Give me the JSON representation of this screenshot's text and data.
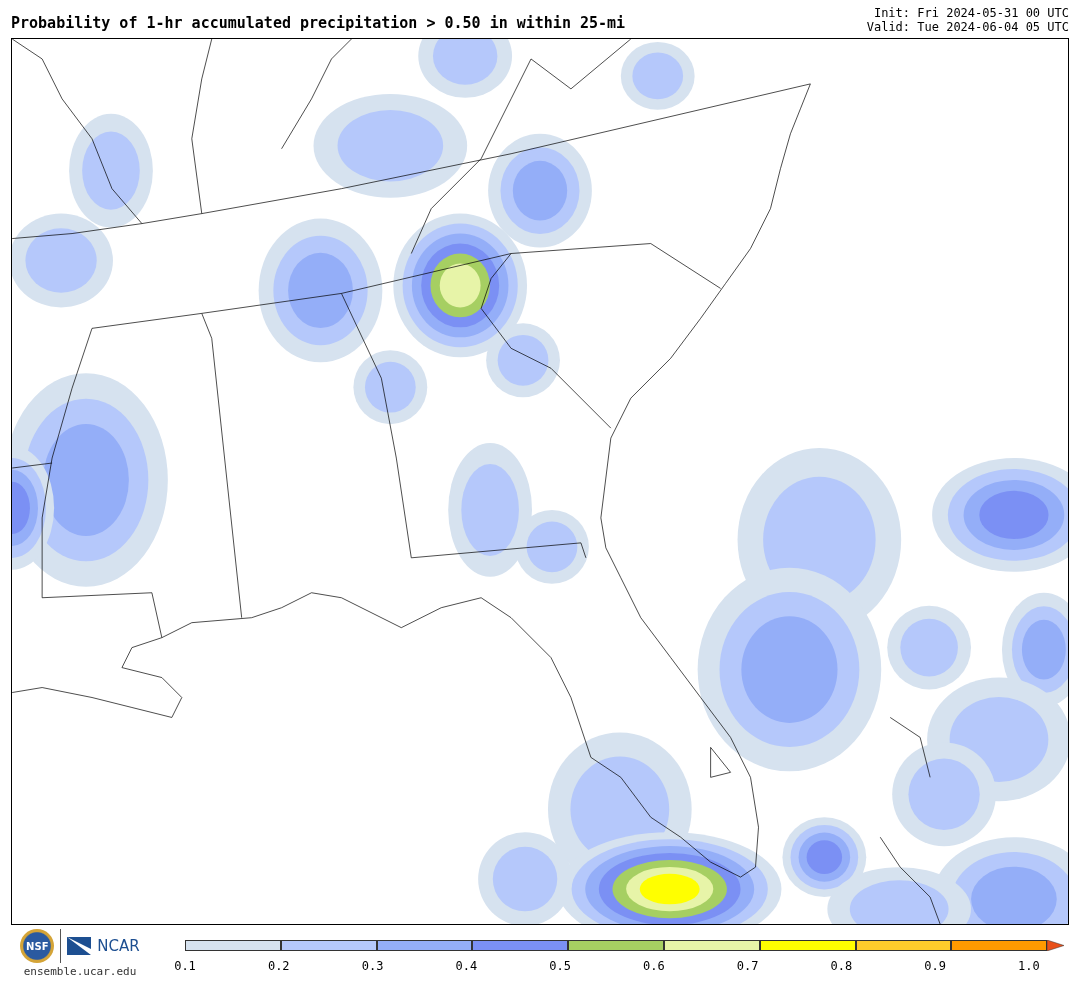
{
  "title": "Probability of 1-hr accumulated precipitation > 0.50 in within 25-mi",
  "init": "Init: Fri 2024-05-31 00 UTC",
  "valid": "Valid: Tue 2024-06-04 05 UTC",
  "logos": {
    "nsf": "NSF",
    "ncar": "NCAR",
    "site": "ensemble.ucar.edu"
  },
  "colorbar": {
    "segments": [
      {
        "color": "#d6e2ef"
      },
      {
        "color": "#b5c8fb"
      },
      {
        "color": "#94aef8"
      },
      {
        "color": "#7b90f4"
      },
      {
        "color": "#a6cf62"
      },
      {
        "color": "#e7f4a8"
      },
      {
        "color": "#ffff00"
      },
      {
        "color": "#ffcd2b"
      },
      {
        "color": "#ff9a00"
      }
    ],
    "overflow": {
      "color": "#e8501a"
    },
    "ticks": [
      "0.1",
      "0.2",
      "0.3",
      "0.4",
      "0.5",
      "0.6",
      "0.7",
      "0.8",
      "0.9",
      "1.0"
    ]
  }
}
